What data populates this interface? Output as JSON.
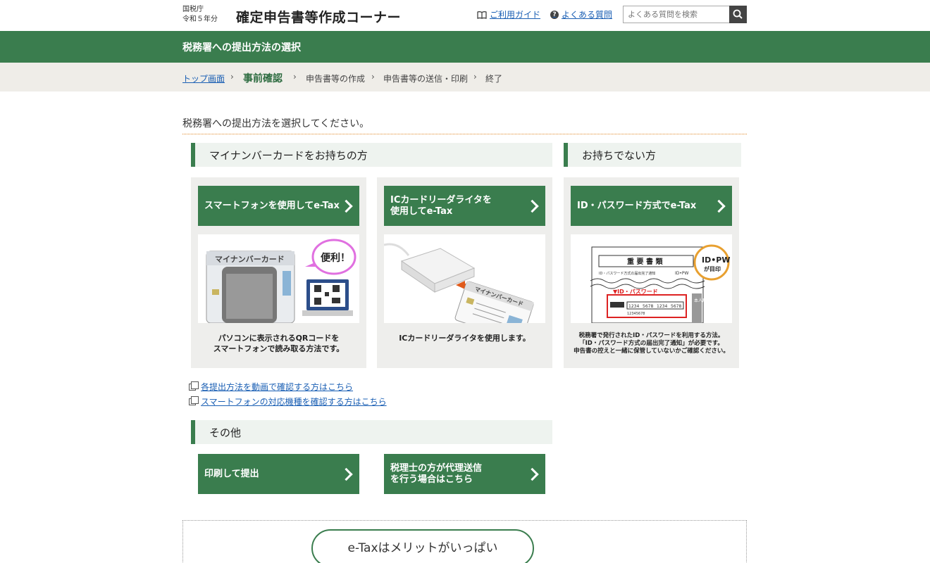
{
  "header": {
    "agency_line1": "国税庁",
    "agency_line2": "令和５年分",
    "site_title": "確定申告書等作成コーナー",
    "guide_link": "ご利用ガイド",
    "faq_link": "よくある質問",
    "search_placeholder": "よくある質問を検索"
  },
  "page_title": "税務署への提出方法の選択",
  "breadcrumb": {
    "items": [
      "トップ画面",
      "事前確認",
      "申告書等の作成",
      "申告書等の送信・印刷",
      "終了"
    ],
    "separator": "›"
  },
  "instruction": "税務署への提出方法を選択してください。",
  "sections": {
    "with_card": "マイナンバーカードをお持ちの方",
    "without_card": "お持ちでない方",
    "other": "その他"
  },
  "cards": [
    {
      "button_label": "スマートフォンを使用してe-Tax",
      "illustration": {
        "card_label": "マイナンバーカード",
        "bubble": "便利！"
      },
      "description": "パソコンに表示されるQRコードを\nスマートフォンで読み取る方法です。"
    },
    {
      "button_label": "ICカードリーダライタを\n使用してe-Tax",
      "illustration": {
        "card_label": "マイナンバーカード"
      },
      "description": "ICカードリーダライタを使用します。"
    },
    {
      "button_label": "ID・パスワード方式でe-Tax",
      "illustration": {
        "doc_title": "重 要 書 類",
        "doc_subtitle": "ID・パスワード方式の届出完了通知",
        "doc_tag": "ID•PW",
        "id_header": "▼ID・パスワード",
        "id_numbers": [
          "1234",
          "5678",
          "1234",
          "5678"
        ],
        "id_small": "12345678",
        "stamp_line1": "ID•PW",
        "stamp_line2": "が目印",
        "side_label": "本人用"
      },
      "description": "税務署で発行されたID・パスワードを利用する方法。\n「ID・パスワード方式の届出完了通知」が必要です。\n申告書の控えと一緒に保管していないかご確認ください。"
    }
  ],
  "links": {
    "video": "各提出方法を動画で確認する方はこちら",
    "devices": "スマートフォンの対応機種を確認する方はこちら"
  },
  "other_buttons": {
    "print": "印刷して提出",
    "tax_accountant": "税理士の方が代理送信\nを行う場合はこちら"
  },
  "merit": "e-Taxはメリットがいっぱい",
  "colors": {
    "primary_green": "#3a7d4e",
    "breadcrumb_bg": "#efede8",
    "link": "#1a5fb4",
    "dotted_orange": "#e08a2a"
  }
}
